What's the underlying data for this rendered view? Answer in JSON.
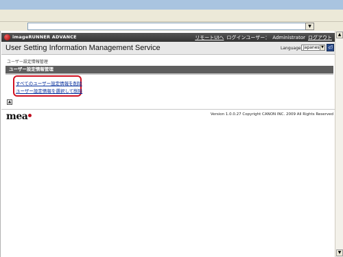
{
  "browser": {
    "address_dropdown_glyph": "▼"
  },
  "header": {
    "product_name": "imageRUNNER ADVANCE",
    "remote_ui_link": "リモートUIへ",
    "login_user_label": "ログインユーザー：",
    "user_name": "Administrator",
    "logout_link": "ログアウト"
  },
  "title_bar": {
    "title": "User Setting Information Management Service",
    "language_label": "Language",
    "language_value": "Japanese",
    "apply_glyph": "⏎"
  },
  "breadcrumb": "ユーザー設定情報管理",
  "section": {
    "header": "ユーザー設定情報管理",
    "links": [
      "すべてのユーザー設定情報を削除",
      "ユーザー設定情報を選択して削除"
    ]
  },
  "scroll_top_glyph": "▲",
  "footer": {
    "logo": "mea",
    "copyright": "Version 1.0.0.27 Copyright CANON INC. 2009 All Rights Reserved"
  },
  "colors": {
    "header_bg": "#333333",
    "section_bg": "#5e5e5e",
    "link": "#002a9a",
    "highlight": "#d01020"
  }
}
